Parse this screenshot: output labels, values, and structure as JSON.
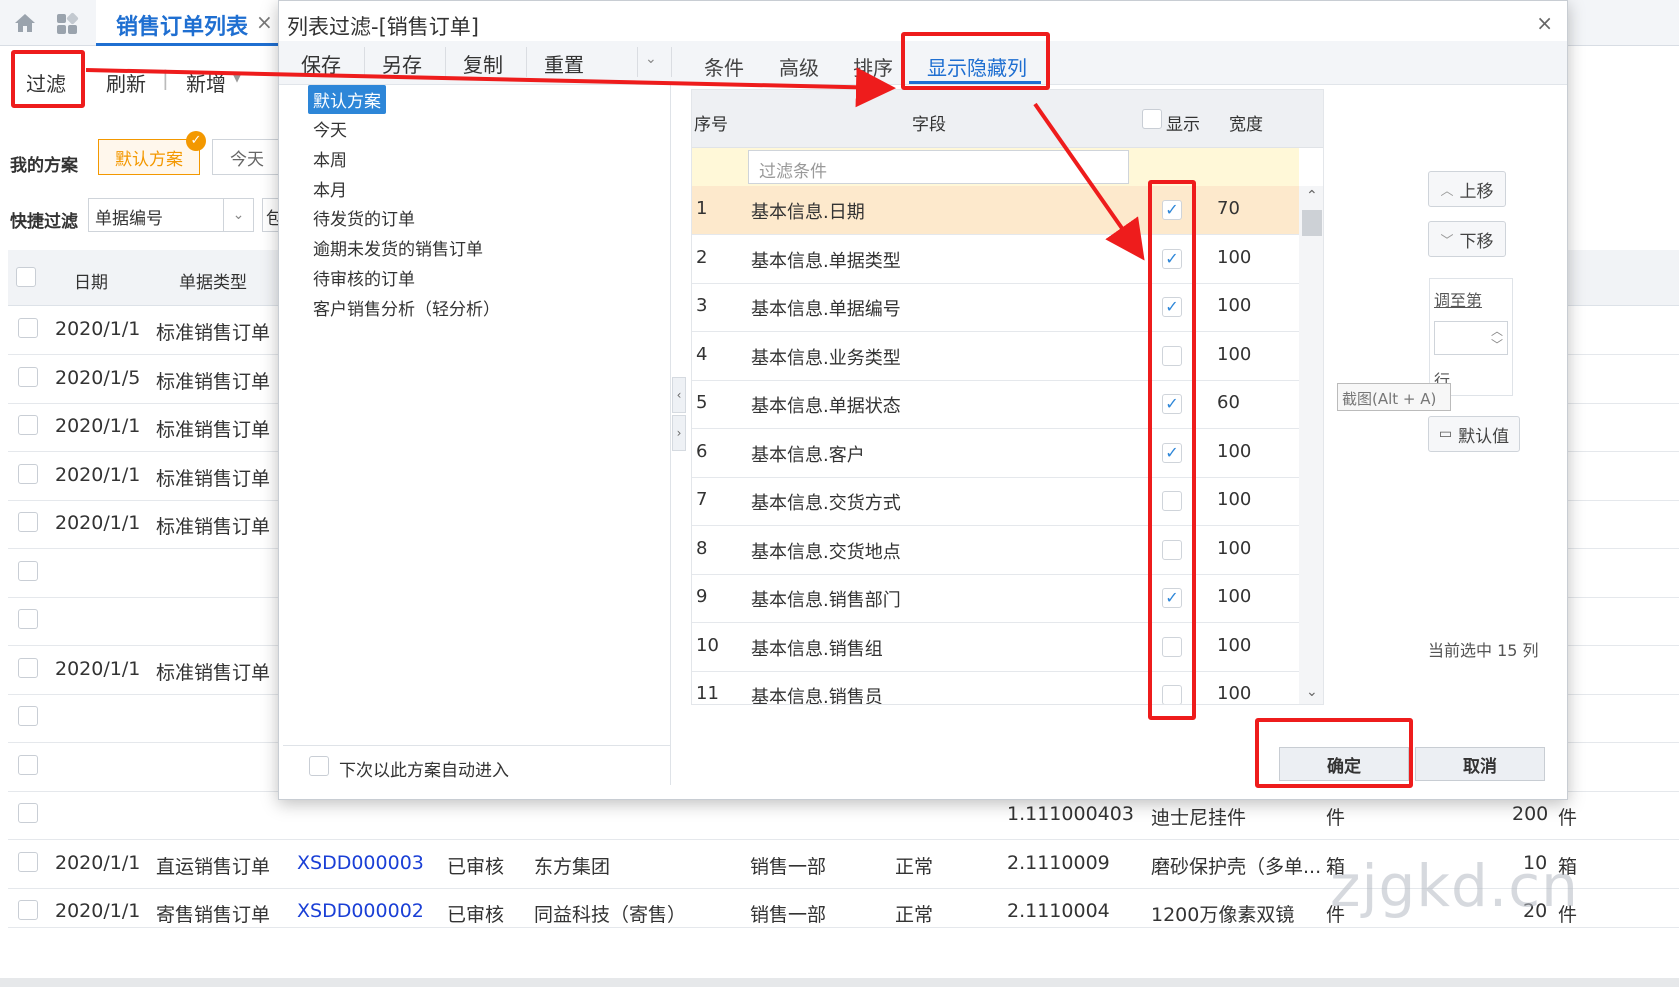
{
  "bg": {
    "tab_title": "销售订单列表",
    "tab_close": "×",
    "toolbar": {
      "filter": "过滤",
      "refresh": "刷新",
      "sep": "|",
      "new": "新增"
    },
    "my_plans_label": "我的方案",
    "plan_default": "默认方案",
    "plan_today": "今天",
    "quick_filter_label": "快捷过滤",
    "quick_filter_field": "单据编号",
    "quick_filter_op": "包",
    "grid_headers": {
      "date": "日期",
      "type": "单据类型"
    },
    "rows": [
      {
        "date": "2020/1/1",
        "type": "标准销售订单"
      },
      {
        "date": "2020/1/5",
        "type": "标准销售订单"
      },
      {
        "date": "2020/1/1",
        "type": "标准销售订单"
      },
      {
        "date": "2020/1/1",
        "type": "标准销售订单"
      },
      {
        "date": "2020/1/1",
        "type": "标准销售订单"
      },
      {
        "date": "",
        "type": ""
      },
      {
        "date": "",
        "type": ""
      },
      {
        "date": "2020/1/1",
        "type": "标准销售订单"
      },
      {
        "date": "",
        "type": ""
      },
      {
        "date": "",
        "type": ""
      }
    ],
    "row_material": {
      "code": "1.111000403",
      "name": "迪士尼挂件",
      "unit": "件",
      "qty": "200",
      "extra": "件"
    },
    "row_full1": {
      "date": "2020/1/1",
      "type": "直运销售订单",
      "no": "XSDD000003",
      "status": "已审核",
      "customer": "东方集团",
      "dept": "销售一部",
      "state": "正常",
      "code": "2.1110009",
      "name": "磨砂保护壳（多单...",
      "unit": "箱",
      "qty": "10",
      "extra": "箱"
    },
    "row_full2": {
      "date": "2020/1/1",
      "type": "寄售销售订单",
      "no": "XSDD000002",
      "status": "已审核",
      "customer": "同益科技（寄售）",
      "dept": "销售一部",
      "state": "正常",
      "code": "2.1110004",
      "name": "1200万像素双镜",
      "unit": "件",
      "qty": "20",
      "extra": "件"
    }
  },
  "dialog": {
    "title": "列表过滤-[销售订单]",
    "close": "×",
    "actions": {
      "save": "保存",
      "save_as": "另存",
      "copy": "复制",
      "reset": "重置"
    },
    "tabs": {
      "condition": "条件",
      "advanced": "高级",
      "sort": "排序",
      "columns": "显示隐藏列"
    },
    "schemes": [
      "默认方案",
      "今天",
      "本周",
      "本月",
      "待发货的订单",
      "逾期未发货的销售订单",
      "待审核的订单",
      "客户销售分析（轻分析）"
    ],
    "auto_enter": "下次以此方案自动进入",
    "grid": {
      "h_no": "序号",
      "h_field": "字段",
      "h_show": "显示",
      "h_width": "宽度",
      "filter_placeholder": "过滤条件",
      "rows": [
        {
          "no": "1",
          "field": "基本信息.日期",
          "show": "✓",
          "width": "70"
        },
        {
          "no": "2",
          "field": "基本信息.单据类型",
          "show": "✓",
          "width": "100"
        },
        {
          "no": "3",
          "field": "基本信息.单据编号",
          "show": "✓",
          "width": "100"
        },
        {
          "no": "4",
          "field": "基本信息.业务类型",
          "show": "",
          "width": "100"
        },
        {
          "no": "5",
          "field": "基本信息.单据状态",
          "show": "✓",
          "width": "60"
        },
        {
          "no": "6",
          "field": "基本信息.客户",
          "show": "✓",
          "width": "100"
        },
        {
          "no": "7",
          "field": "基本信息.交货方式",
          "show": "",
          "width": "100"
        },
        {
          "no": "8",
          "field": "基本信息.交货地点",
          "show": "",
          "width": "100"
        },
        {
          "no": "9",
          "field": "基本信息.销售部门",
          "show": "✓",
          "width": "100"
        },
        {
          "no": "10",
          "field": "基本信息.销售组",
          "show": "",
          "width": "100"
        },
        {
          "no": "11",
          "field": "基本信息.销售员",
          "show": "",
          "width": "100"
        }
      ]
    },
    "move_up": "上移",
    "move_down": "下移",
    "goto_label": "调至第",
    "goto_suffix": "行",
    "default_value": "默认值",
    "selected_count": "当前选中 15 列",
    "tooltip": "截图(Alt + A)",
    "ok": "确定",
    "cancel": "取消"
  },
  "watermark": "zjgkd.cn",
  "colors": {
    "accent": "#1f6fd1",
    "annotation": "#ee1c1c",
    "plan_active": "#f39800",
    "link": "#1a3fd6"
  }
}
